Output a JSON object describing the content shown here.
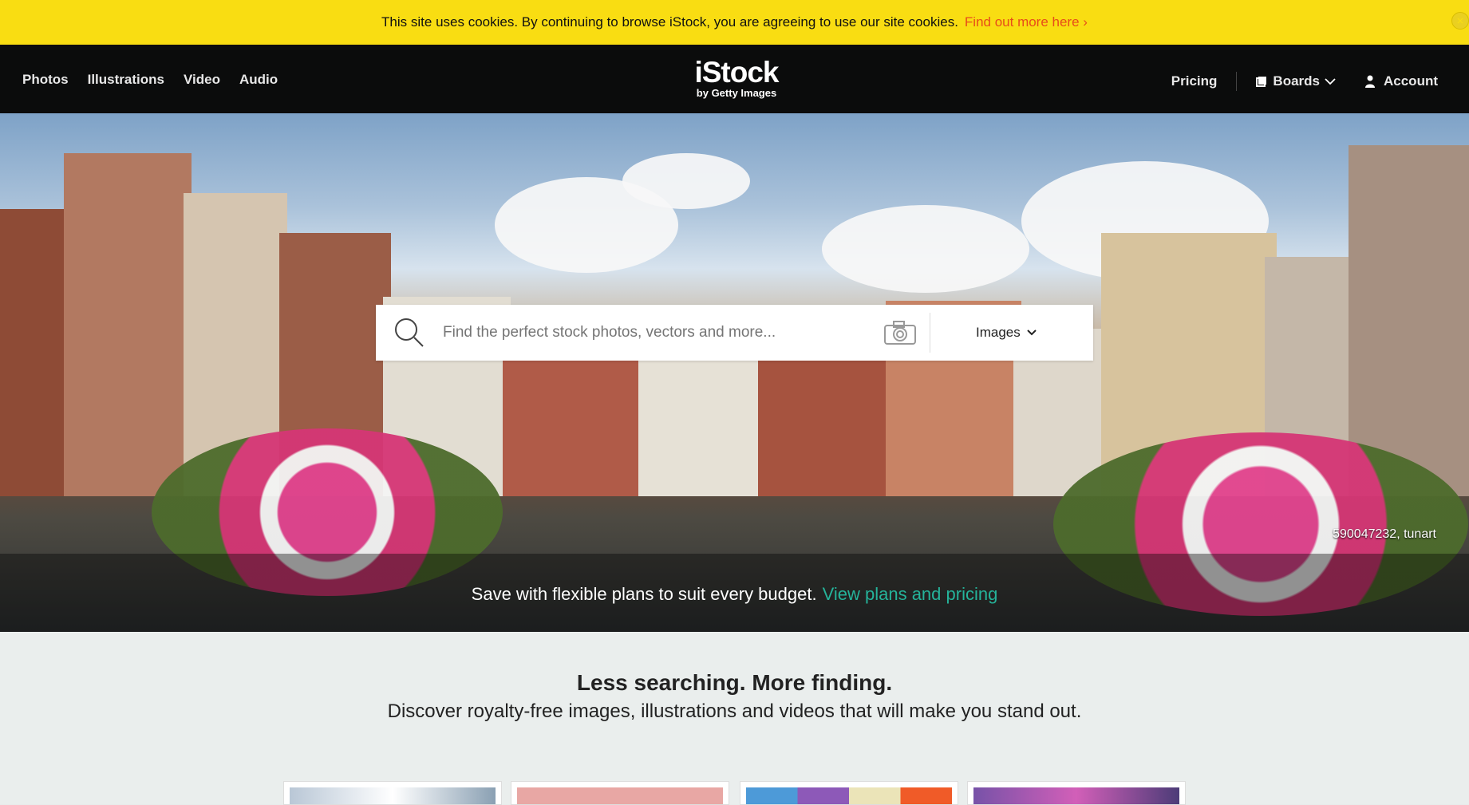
{
  "cookie": {
    "message": "This site uses cookies. By continuing to browse iStock, you are agreeing to use our site cookies.",
    "link": "Find out more here ›",
    "close": "×"
  },
  "nav": {
    "left": [
      "Photos",
      "Illustrations",
      "Video",
      "Audio"
    ],
    "logo": {
      "brand": "iStock",
      "tagline": "by Getty Images"
    },
    "pricing": "Pricing",
    "boards": "Boards",
    "account": "Account"
  },
  "search": {
    "placeholder": "Find the perfect stock photos, vectors and more...",
    "type": "Images"
  },
  "hero": {
    "promo_text": "Save with flexible plans to suit every budget.",
    "promo_link": "View plans and pricing",
    "credit": "590047232, tunart"
  },
  "main": {
    "headline": "Less searching. More finding.",
    "subheadline": "Discover royalty-free images, illustrations and videos that will make you stand out."
  },
  "colors": {
    "cookie_bg": "#f9dd12",
    "nav_bg": "#0b0c0c",
    "accent_orange": "#e74c1a",
    "accent_green": "#25b39a"
  }
}
